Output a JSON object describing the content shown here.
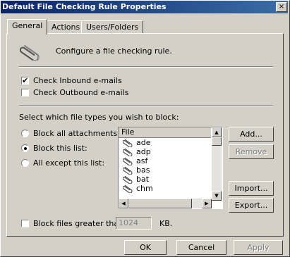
{
  "window": {
    "title": "Default File Checking Rule Properties",
    "close_glyph": "×"
  },
  "tabs": [
    {
      "label": "General",
      "active": true
    },
    {
      "label": "Actions",
      "active": false
    },
    {
      "label": "Users/Folders",
      "active": false
    }
  ],
  "general": {
    "intro_text": "Configure a file checking rule.",
    "check_inbound_label": "Check Inbound e-mails",
    "check_inbound_checked": true,
    "check_outbound_label": "Check Outbound e-mails",
    "check_outbound_checked": false,
    "select_types_label": "Select which file types you wish to block:",
    "radio_block_all": "Block all attachments",
    "radio_block_list": "Block this list:",
    "radio_all_except": "All except this list:",
    "selected_radio": "Block this list:"
  },
  "file_list": {
    "header": "File",
    "items": [
      "ade",
      "adp",
      "asf",
      "bas",
      "bat",
      "chm"
    ]
  },
  "side_buttons": {
    "add": "Add...",
    "remove": "Remove",
    "import": "Import...",
    "export": "Export..."
  },
  "size_limit": {
    "label": "Block files greater than",
    "checked": false,
    "value": "1024",
    "unit": "KB."
  },
  "footer": {
    "ok": "OK",
    "cancel": "Cancel",
    "apply": "Apply"
  },
  "colors": {
    "title_bar_start": "#0a246a",
    "title_bar_end": "#3a6ea5",
    "dialog_face": "#d4d0c8"
  }
}
